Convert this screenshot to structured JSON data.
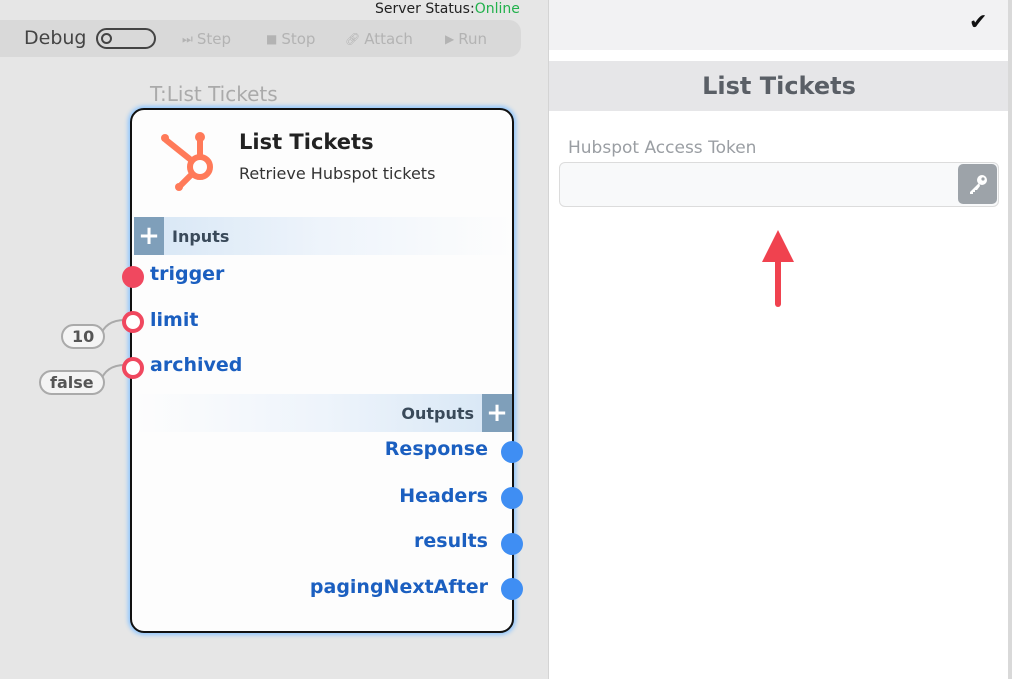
{
  "server": {
    "label": "Server Status:",
    "status": "Online"
  },
  "debug": {
    "label": "Debug",
    "buttons": [
      {
        "label": "Step",
        "icon": "step-icon"
      },
      {
        "label": "Stop",
        "icon": "stop-icon"
      },
      {
        "label": "Attach",
        "icon": "link-icon"
      },
      {
        "label": "Run",
        "icon": "play-icon"
      }
    ]
  },
  "node": {
    "type_label": "T:List Tickets",
    "title": "List Tickets",
    "subtitle": "Retrieve Hubspot tickets",
    "icon": "hubspot-icon",
    "inputs_label": "Inputs",
    "outputs_label": "Outputs",
    "inputs": [
      {
        "name": "trigger"
      },
      {
        "name": "limit",
        "value": "10"
      },
      {
        "name": "archived",
        "value": "false"
      }
    ],
    "outputs": [
      {
        "name": "Response"
      },
      {
        "name": "Headers"
      },
      {
        "name": "results"
      },
      {
        "name": "pagingNextAfter"
      }
    ]
  },
  "panel": {
    "title": "List Tickets",
    "field_label": "Hubspot Access Token",
    "field_value": "",
    "field_placeholder": ""
  },
  "colors": {
    "online": "#22b14c",
    "hubspot": "#ff7a59",
    "pin_input": "#f0485f",
    "pin_output": "#3f8ef3",
    "pin_label": "#1b5fc0",
    "arrow": "#f0424f"
  }
}
